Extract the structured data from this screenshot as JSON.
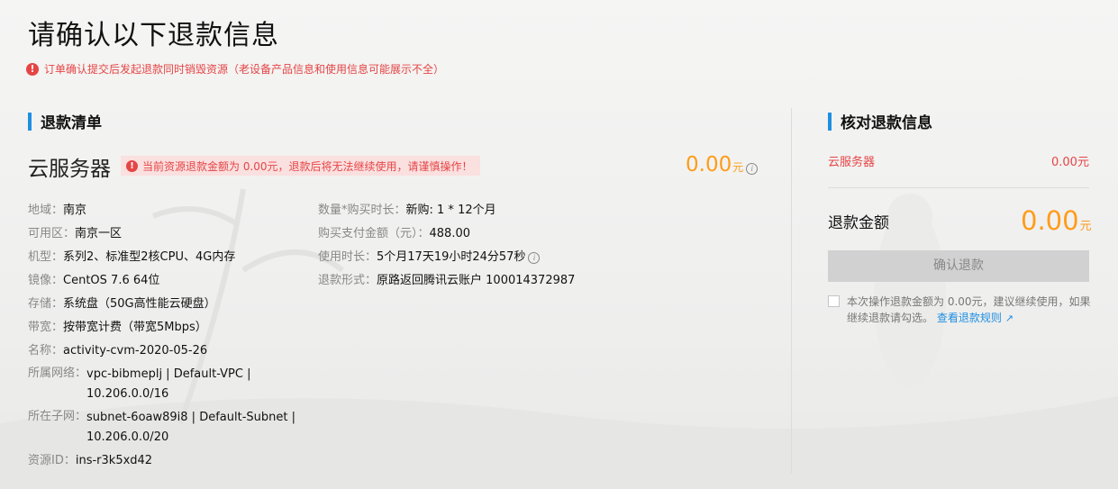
{
  "page": {
    "title": "请确认以下退款信息",
    "notice": "订单确认提交后发起退款同时销毁资源（老设备产品信息和使用信息可能展示不全）"
  },
  "refund_list": {
    "heading": "退款清单",
    "product_name": "云服务器",
    "product_warning": "当前资源退款金额为 0.00元，退款后将无法继续使用，请谨慎操作！",
    "amount": "0.00",
    "amount_unit": "元",
    "left_fields": [
      {
        "label": "地域：",
        "value": "南京"
      },
      {
        "label": "可用区：",
        "value": "南京一区"
      },
      {
        "label": "机型：",
        "value": "系列2、标准型2核CPU、4G内存"
      },
      {
        "label": "镜像：",
        "value": "CentOS 7.6 64位"
      },
      {
        "label": "存储：",
        "value": "系统盘（50G高性能云硬盘）"
      },
      {
        "label": "带宽：",
        "value": "按带宽计费（带宽5Mbps）"
      },
      {
        "label": "名称：",
        "value": "activity-cvm-2020-05-26"
      },
      {
        "label": "所属网络：",
        "value": "vpc-bibmeplj | Default-VPC | 10.206.0.0/16"
      },
      {
        "label": "所在子网：",
        "value": "subnet-6oaw89i8 | Default-Subnet | 10.206.0.0/20"
      },
      {
        "label": "资源ID：",
        "value": "ins-r3k5xd42"
      }
    ],
    "right_fields": [
      {
        "label": "数量*购买时长：",
        "value": "新购: 1 * 12个月"
      },
      {
        "label": "购买支付金额（元）：",
        "value": "488.00"
      },
      {
        "label": "使用时长：",
        "value": "5个月17天19小时24分57秒"
      },
      {
        "label": "退款形式：",
        "value": "原路返回腾讯云账户 100014372987"
      }
    ]
  },
  "check_panel": {
    "heading": "核对退款信息",
    "product_name": "云服务器",
    "product_amount": "0.00元",
    "total_label": "退款金额",
    "total_amount": "0.00",
    "total_unit": "元",
    "confirm_button": "确认退款",
    "agreement_text": "本次操作退款金额为 0.00元，建议继续使用，如果继续退款请勾选。",
    "rules_link": "查看退款规则"
  },
  "colors": {
    "accent": "#1f8fe0",
    "price": "#ff9c19",
    "warning": "#e54545",
    "disabled_button": "#d1d1d1"
  },
  "icons": [
    "warning-icon",
    "info-icon",
    "external-link-icon",
    "checkbox"
  ]
}
